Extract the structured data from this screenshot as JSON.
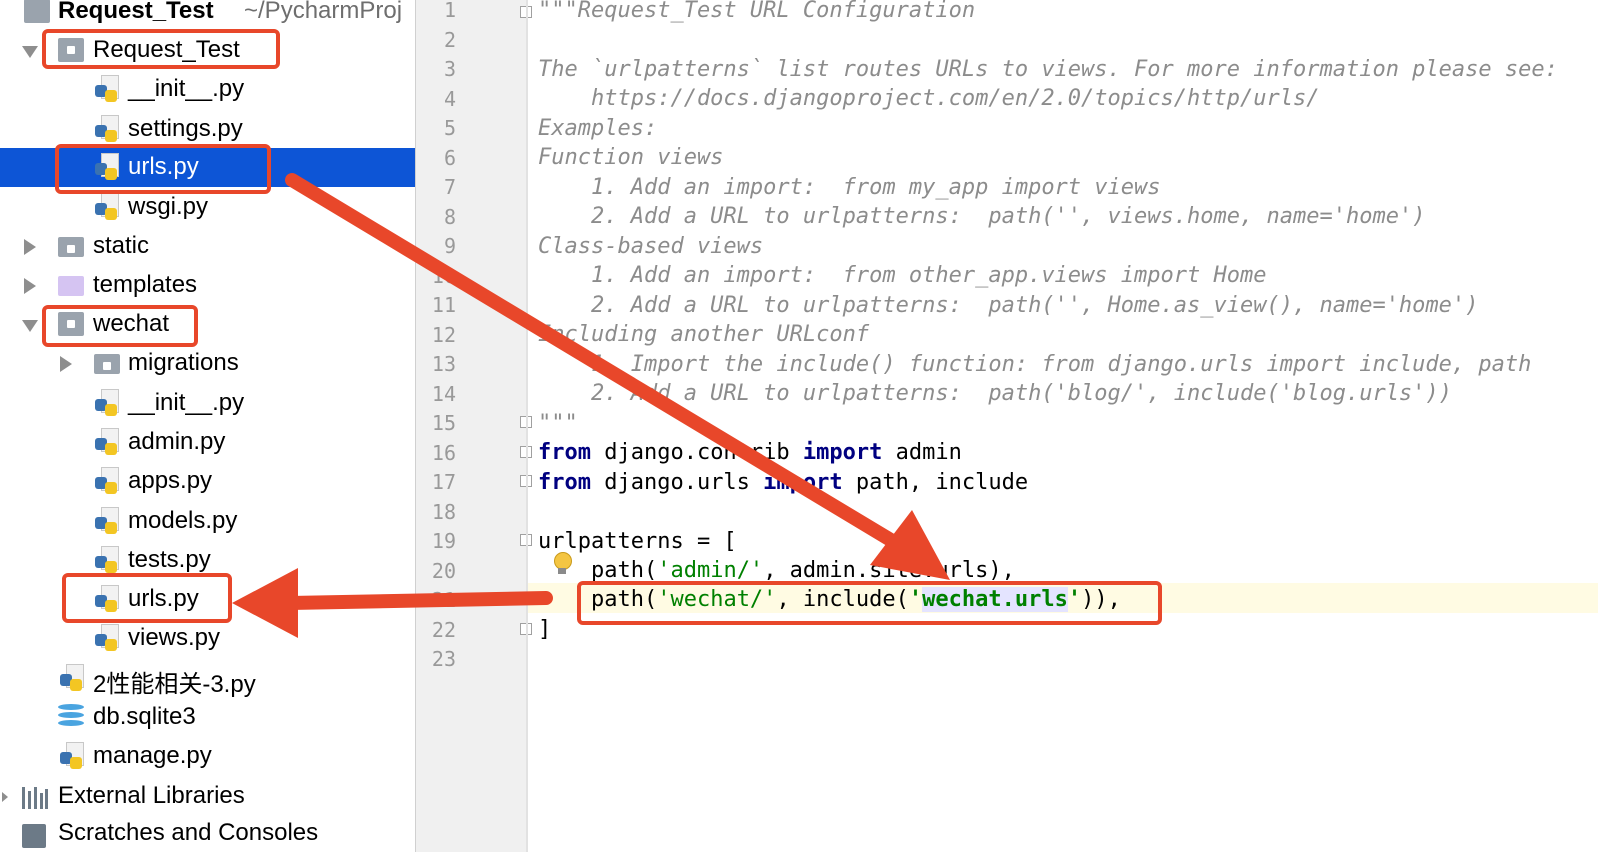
{
  "project_tree": {
    "root": {
      "label": "Request_Test",
      "path": "~/PycharmProj"
    },
    "items": [
      {
        "label": "Request_Test",
        "kind": "folder"
      },
      {
        "label": "__init__.py",
        "kind": "python"
      },
      {
        "label": "settings.py",
        "kind": "python"
      },
      {
        "label": "urls.py",
        "kind": "python",
        "selected": true
      },
      {
        "label": "wsgi.py",
        "kind": "python"
      },
      {
        "label": "static",
        "kind": "folder"
      },
      {
        "label": "templates",
        "kind": "folder"
      },
      {
        "label": "wechat",
        "kind": "folder"
      },
      {
        "label": "migrations",
        "kind": "folder"
      },
      {
        "label": "__init__.py",
        "kind": "python"
      },
      {
        "label": "admin.py",
        "kind": "python"
      },
      {
        "label": "apps.py",
        "kind": "python"
      },
      {
        "label": "models.py",
        "kind": "python"
      },
      {
        "label": "tests.py",
        "kind": "python"
      },
      {
        "label": "urls.py",
        "kind": "python"
      },
      {
        "label": "views.py",
        "kind": "python"
      },
      {
        "label": "2性能相关-3.py",
        "kind": "python"
      },
      {
        "label": "db.sqlite3",
        "kind": "database"
      },
      {
        "label": "manage.py",
        "kind": "python"
      }
    ],
    "external_libraries": "External Libraries",
    "scratches": "Scratches and Consoles"
  },
  "editor": {
    "line_numbers": [
      "1",
      "2",
      "3",
      "4",
      "5",
      "6",
      "7",
      "8",
      "9",
      "10",
      "11",
      "12",
      "13",
      "14",
      "15",
      "16",
      "17",
      "18",
      "19",
      "20",
      "21",
      "22",
      "23"
    ],
    "lines": {
      "l1": "\"\"\"Request_Test URL Configuration",
      "l3": "The `urlpatterns` list routes URLs to views. For more information please see:",
      "l4": "    https://docs.djangoproject.com/en/2.0/topics/http/urls/",
      "l5": "Examples:",
      "l6": "Function views",
      "l7": "    1. Add an import:  from my_app import views",
      "l8": "    2. Add a URL to urlpatterns:  path('', views.home, name='home')",
      "l9": "Class-based views",
      "l10": "    1. Add an import:  from other_app.views import Home",
      "l11": "    2. Add a URL to urlpatterns:  path('', Home.as_view(), name='home')",
      "l12": "Including another URLconf",
      "l13": "    1. Import the include() function: from django.urls import include, path",
      "l14": "    2. Add a URL to urlpatterns:  path('blog/', include('blog.urls'))",
      "l15": "\"\"\"",
      "l16_kw1": "from",
      "l16_mid": " django.contrib ",
      "l16_kw2": "import",
      "l16_end": " admin",
      "l17_kw1": "from",
      "l17_mid": " django.urls ",
      "l17_kw2": "import",
      "l17_end": " path, include",
      "l19": "urlpatterns = [",
      "l20_a": "    path(",
      "l20_s": "'admin/'",
      "l20_b": ", admin.site.urls),",
      "l21_a": "    path(",
      "l21_s": "'wechat/'",
      "l21_b": ", include(",
      "l21_q1": "'",
      "l21_s2": "wechat.urls",
      "l21_q2": "'",
      "l21_c": ")),",
      "l22": "]"
    }
  },
  "annotation_color": "#e8472a",
  "selection_color": "#0d55d6"
}
